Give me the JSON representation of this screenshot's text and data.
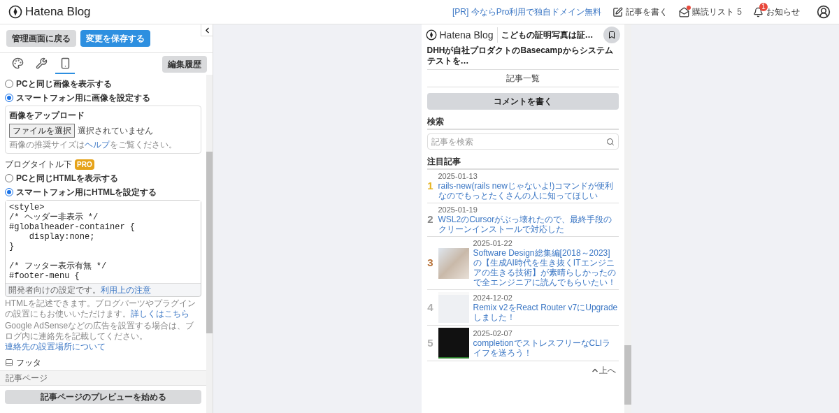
{
  "header": {
    "logo": "Hatena Blog",
    "promo": "[PR] 今ならPro利用で独自ドメイン無料",
    "write": "記事を書く",
    "reading_list": "購読リスト",
    "reading_count": "5",
    "reading_dot": true,
    "notifications": "お知らせ",
    "notification_badge": "1"
  },
  "sidebar": {
    "back_button": "管理画面に戻る",
    "save_button": "変更を保存する",
    "tabs": [
      {
        "selected": false
      },
      {
        "selected": false
      },
      {
        "selected": true
      }
    ],
    "history_button": "編集履歴",
    "header_image_options": [
      {
        "label": "PCと同じ画像を表示する",
        "selected": false
      },
      {
        "label": "スマートフォン用に画像を設定する",
        "selected": true
      }
    ],
    "upload": {
      "label": "画像をアップロード",
      "file_button": "ファイルを選択",
      "file_status": "選択されていません",
      "help_before": "画像の推奨サイズは",
      "help_link": "ヘルプ",
      "help_after": "をご覧ください。"
    },
    "subtitle_section": {
      "title": "ブログタイトル下",
      "badge": "PRO",
      "options": [
        {
          "label": "PCと同じHTMLを表示する",
          "selected": false
        },
        {
          "label": "スマートフォン用にHTMLを設定する",
          "selected": true
        }
      ],
      "code": "<style>\n/* ヘッダー非表示 */\n#globalheader-container {\n    display:none;\n}\n\n/* フッター表示有無 */\n#footer-menu {",
      "dev_note": "開発者向けの設定です。",
      "dev_link": "利用上の注意",
      "desc": "HTMLを記述できます。ブログパーツやプラグインの設置にもお使いいただけます。",
      "desc_link": "詳しくはこちら",
      "adsense": "Google AdSenseなどの広告を設置する場合は、ブログ内に連絡先を記載してください。",
      "adsense_link": "連絡先の設置場所について"
    },
    "footer_item": "フッタ",
    "article_page": "記事ページ",
    "preview_button": "記事ページのプレビューを始める"
  },
  "preview": {
    "logo": "Hatena Blog",
    "blog_title": "こどもの証明写真は証…",
    "prev_entry": "DHHが自社プロダクトのBasecampからシステムテストを…",
    "archive_link": "記事一覧",
    "comment_button": "コメントを書く",
    "search_heading": "検索",
    "search_placeholder": "記事を検索",
    "featured_heading": "注目記事",
    "entries": [
      {
        "rank": "1",
        "color": "#e6b422",
        "date": "2025-01-13",
        "title": "rails-new(rails newじゃないよ!)コマンドが便利なのでもっとたくさんの人に知ってほしい",
        "kind": "plain"
      },
      {
        "rank": "2",
        "color": "#8a8a8a",
        "date": "2025-01-19",
        "title": "WSL2のCursorがぶっ壊れたので、最終手段のクリーンインストールで対応した",
        "kind": "plain"
      },
      {
        "rank": "3",
        "color": "#b8733a",
        "date": "2025-01-22",
        "title": "Software Design総集編[2018～2023]の【生成AI時代を生き抜くITエンジニアの生きる技術】が素晴らしかったので全エンジニアに読んでもらいたい！",
        "kind": "book"
      },
      {
        "rank": "4",
        "color": "#b0b0b0",
        "date": "2024-12-02",
        "title": "Remix v2をReact Router v7にUpgradeしました！",
        "kind": "screen"
      },
      {
        "rank": "5",
        "color": "#b0b0b0",
        "date": "2025-02-07",
        "title": "completionでストレスフリーなCLIライフを送ろう！",
        "kind": "terminal"
      }
    ],
    "to_top": "上へ"
  }
}
